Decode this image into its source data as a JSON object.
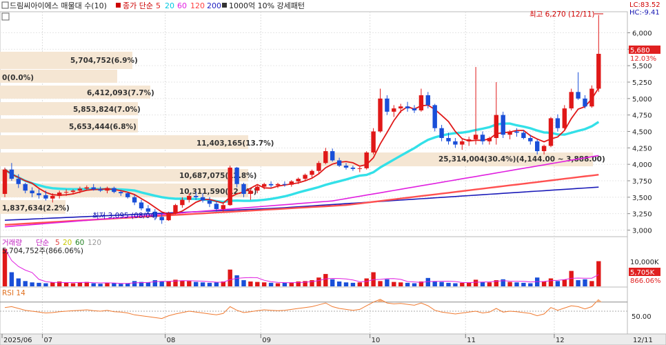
{
  "header": {
    "stock_name": "드림씨아이에스 매물대 수(10)",
    "ma_label": "종가 단순",
    "ma_periods": [
      "5",
      "20",
      "60",
      "120",
      "200"
    ],
    "ma_colors": [
      "#e02020",
      "#00d8e8",
      "#e020e0",
      "#ff4040",
      "#2020c0"
    ],
    "pattern_label": "1000억 10% 강세패턴"
  },
  "price_panel": {
    "high_annotation": "최고 6,270 (12/11)",
    "low_annotation": "최저 3,095 (08/04)",
    "lc_label": "LC:83.52",
    "hc_label": "HC:-9.41",
    "current_price_tag": "5,680",
    "current_change_tag": "12.03%",
    "y_ticks": [
      "6,000",
      "5,750",
      "5,500",
      "5,250",
      "5,000",
      "4,750",
      "4,500",
      "4,250",
      "4,000",
      "3,750",
      "3,500",
      "3,250",
      "3,000"
    ]
  },
  "volume_profile": [
    {
      "label": "5,704,752(6.9%)"
    },
    {
      "label": "0(0.0%)"
    },
    {
      "label": "6,412,093(7.7%)"
    },
    {
      "label": "5,853,824(7.0%)"
    },
    {
      "label": "5,653,444(6.8%)"
    },
    {
      "label": "11,403,165(13.7%)"
    },
    {
      "label": "25,314,004(30.4%)(4,144.00 ~ 3,888.00)"
    },
    {
      "label": "10,687,075(12.8%)"
    },
    {
      "label": "10,311,590(12.4%)"
    },
    {
      "label": "1,837,634(2.2%)"
    }
  ],
  "volume_panel": {
    "title": "거래량",
    "ma_label": "단순",
    "ma_periods": [
      "5",
      "20",
      "60",
      "120"
    ],
    "max_label": "5,704,752주(866.06%)",
    "y_tick": "10,000K",
    "current_tag": "5,705K",
    "current_pct_tag": "866.06%"
  },
  "rsi_panel": {
    "title": "RSI 14",
    "y_tick": "50.00"
  },
  "x_axis": {
    "labels": [
      "2025/06",
      "07",
      "08",
      "09",
      "10",
      "11",
      "12",
      "12/11"
    ]
  },
  "chart_data": {
    "type": "candlestick",
    "y_axis": {
      "min": 2900,
      "max": 6320
    },
    "candles": [
      [
        3550,
        3950,
        3500,
        3920
      ],
      [
        3920,
        4020,
        3750,
        3780
      ],
      [
        3780,
        3850,
        3640,
        3700
      ],
      [
        3700,
        3720,
        3560,
        3600
      ],
      [
        3600,
        3650,
        3500,
        3560
      ],
      [
        3560,
        3620,
        3480,
        3530
      ],
      [
        3530,
        3600,
        3450,
        3480
      ],
      [
        3480,
        3560,
        3420,
        3520
      ],
      [
        3520,
        3600,
        3480,
        3570
      ],
      [
        3570,
        3620,
        3520,
        3580
      ],
      [
        3580,
        3620,
        3540,
        3600
      ],
      [
        3600,
        3660,
        3560,
        3630
      ],
      [
        3630,
        3680,
        3600,
        3650
      ],
      [
        3650,
        3700,
        3600,
        3620
      ],
      [
        3620,
        3660,
        3580,
        3600
      ],
      [
        3600,
        3660,
        3560,
        3640
      ],
      [
        3640,
        3660,
        3560,
        3580
      ],
      [
        3580,
        3600,
        3520,
        3560
      ],
      [
        3560,
        3580,
        3480,
        3500
      ],
      [
        3500,
        3540,
        3380,
        3420
      ],
      [
        3420,
        3460,
        3300,
        3330
      ],
      [
        3330,
        3380,
        3250,
        3280
      ],
      [
        3280,
        3320,
        3150,
        3200
      ],
      [
        3200,
        3260,
        3095,
        3150
      ],
      [
        3150,
        3280,
        3140,
        3260
      ],
      [
        3260,
        3400,
        3240,
        3380
      ],
      [
        3380,
        3500,
        3340,
        3460
      ],
      [
        3460,
        3560,
        3420,
        3520
      ],
      [
        3520,
        3580,
        3460,
        3500
      ],
      [
        3500,
        3560,
        3420,
        3450
      ],
      [
        3450,
        3500,
        3350,
        3400
      ],
      [
        3400,
        3440,
        3280,
        3320
      ],
      [
        3320,
        3420,
        3280,
        3380
      ],
      [
        3380,
        3980,
        3370,
        3950
      ],
      [
        3950,
        3960,
        3650,
        3700
      ],
      [
        3700,
        3720,
        3500,
        3550
      ],
      [
        3550,
        3620,
        3460,
        3600
      ],
      [
        3600,
        3680,
        3560,
        3660
      ],
      [
        3660,
        3720,
        3620,
        3700
      ],
      [
        3700,
        3740,
        3650,
        3680
      ],
      [
        3680,
        3720,
        3640,
        3700
      ],
      [
        3700,
        3740,
        3660,
        3690
      ],
      [
        3690,
        3760,
        3660,
        3740
      ],
      [
        3740,
        3800,
        3700,
        3780
      ],
      [
        3780,
        3860,
        3740,
        3840
      ],
      [
        3840,
        3920,
        3800,
        3900
      ],
      [
        3900,
        4050,
        3860,
        4020
      ],
      [
        4020,
        4250,
        4000,
        4200
      ],
      [
        4200,
        4240,
        4040,
        4060
      ],
      [
        4060,
        4100,
        3960,
        3980
      ],
      [
        3980,
        4020,
        3920,
        3950
      ],
      [
        3950,
        3980,
        3900,
        3930
      ],
      [
        3930,
        3960,
        3880,
        3940
      ],
      [
        3940,
        4200,
        3920,
        4180
      ],
      [
        4180,
        4550,
        4150,
        4500
      ],
      [
        4500,
        5150,
        4480,
        5000
      ],
      [
        5000,
        5050,
        4750,
        4800
      ],
      [
        4800,
        4900,
        4720,
        4850
      ],
      [
        4850,
        4920,
        4780,
        4880
      ],
      [
        4880,
        4950,
        4800,
        4850
      ],
      [
        4850,
        4900,
        4780,
        4820
      ],
      [
        4820,
        5150,
        4800,
        5050
      ],
      [
        5050,
        5100,
        4850,
        4900
      ],
      [
        4900,
        4920,
        4500,
        4550
      ],
      [
        4550,
        4600,
        4350,
        4400
      ],
      [
        4400,
        4480,
        4300,
        4350
      ],
      [
        4350,
        4400,
        4250,
        4300
      ],
      [
        4300,
        4380,
        4220,
        4350
      ],
      [
        4350,
        4420,
        4280,
        4380
      ],
      [
        4380,
        5480,
        4300,
        4450
      ],
      [
        4450,
        4500,
        4300,
        4350
      ],
      [
        4350,
        4420,
        4300,
        4400
      ],
      [
        4400,
        5250,
        4300,
        4750
      ],
      [
        4750,
        4800,
        4400,
        4450
      ],
      [
        4450,
        4520,
        4380,
        4500
      ],
      [
        4500,
        4550,
        4420,
        4480
      ],
      [
        4480,
        4520,
        4380,
        4400
      ],
      [
        4400,
        4450,
        4300,
        4350
      ],
      [
        4350,
        4380,
        4150,
        4200
      ],
      [
        4200,
        4300,
        4150,
        4280
      ],
      [
        4280,
        4720,
        4260,
        4700
      ],
      [
        4700,
        4760,
        4500,
        4550
      ],
      [
        4550,
        4900,
        4520,
        4850
      ],
      [
        4850,
        5150,
        4820,
        5100
      ],
      [
        5100,
        5400,
        4980,
        5000
      ],
      [
        5000,
        5050,
        4850,
        4880
      ],
      [
        4880,
        5200,
        4860,
        5150
      ],
      [
        5150,
        6270,
        5100,
        5680
      ]
    ],
    "volume": [
      8500,
      3200,
      1800,
      1200,
      900,
      800,
      700,
      900,
      1100,
      800,
      700,
      900,
      1000,
      700,
      600,
      800,
      700,
      600,
      700,
      1200,
      1000,
      900,
      1400,
      1100,
      1200,
      1500,
      1300,
      1200,
      1000,
      900,
      800,
      900,
      1100,
      3800,
      2500,
      1400,
      1100,
      1000,
      900,
      800,
      700,
      800,
      900,
      1100,
      1200,
      1400,
      2000,
      2800,
      1600,
      1100,
      900,
      800,
      900,
      1800,
      3200,
      1200,
      1600,
      1000,
      900,
      800,
      700,
      1100,
      1900,
      1100,
      1000,
      800,
      700,
      800,
      900,
      1500,
      1000,
      900,
      1400,
      1600,
      1000,
      900,
      800,
      700,
      2000,
      1100,
      1800,
      1200,
      1500,
      3500,
      1400,
      1600,
      1200,
      5705
    ],
    "rsi": [
      58,
      60,
      56,
      52,
      50,
      48,
      46,
      47,
      49,
      50,
      51,
      52,
      53,
      51,
      50,
      52,
      49,
      48,
      46,
      42,
      40,
      38,
      36,
      34,
      40,
      44,
      47,
      50,
      48,
      46,
      44,
      42,
      45,
      60,
      52,
      47,
      49,
      51,
      53,
      52,
      51,
      52,
      54,
      56,
      58,
      60,
      64,
      68,
      60,
      56,
      54,
      52,
      54,
      62,
      70,
      76,
      68,
      66,
      67,
      65,
      63,
      68,
      62,
      52,
      48,
      46,
      44,
      46,
      48,
      50,
      46,
      48,
      56,
      48,
      50,
      49,
      47,
      45,
      40,
      44,
      58,
      52,
      57,
      62,
      60,
      55,
      60,
      76
    ]
  }
}
